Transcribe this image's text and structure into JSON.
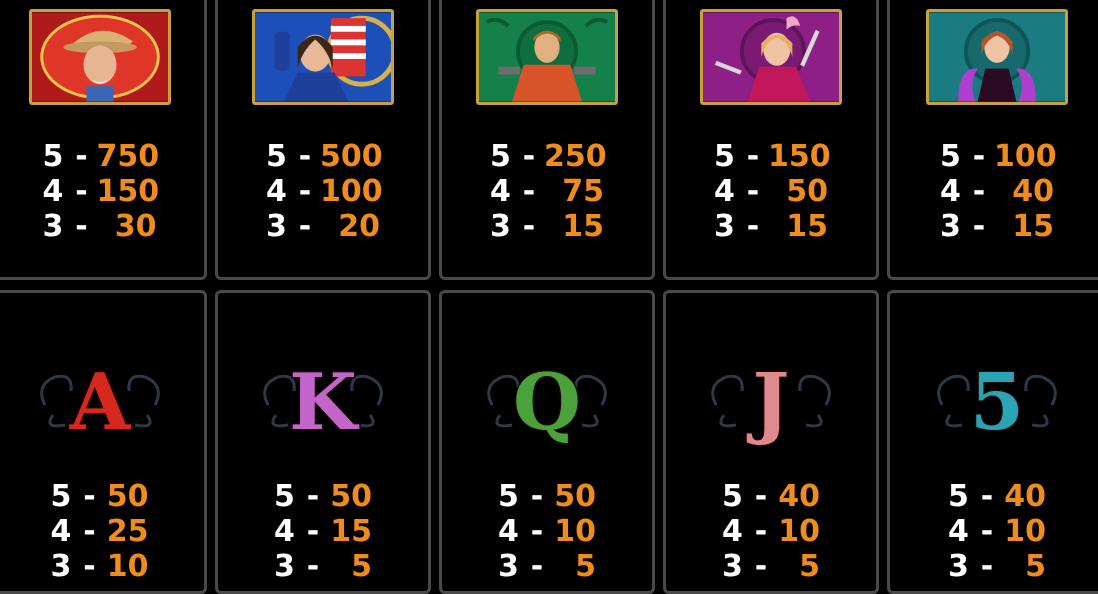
{
  "theme": {
    "background": "#000000",
    "border": "#4a4a4a",
    "count_color": "#ffffff",
    "payout_color": "#f08c1c"
  },
  "symbols": [
    {
      "icon": "old-cowboy-portrait",
      "frame": "#c8a13a",
      "bg": "#b11a1a",
      "payouts": [
        {
          "count": "5",
          "value": "750"
        },
        {
          "count": "4",
          "value": "150"
        },
        {
          "count": "3",
          "value": "30"
        }
      ]
    },
    {
      "icon": "cowgirl-flag-portrait",
      "frame": "#c8a13a",
      "bg": "#1d4fb8",
      "payouts": [
        {
          "count": "5",
          "value": "500"
        },
        {
          "count": "4",
          "value": "100"
        },
        {
          "count": "3",
          "value": "20"
        }
      ]
    },
    {
      "icon": "gunslinger-portrait",
      "frame": "#c8a13a",
      "bg": "#14804a",
      "payouts": [
        {
          "count": "5",
          "value": "250"
        },
        {
          "count": "4",
          "value": "75"
        },
        {
          "count": "3",
          "value": "15"
        }
      ]
    },
    {
      "icon": "knife-girl-portrait",
      "frame": "#c8a13a",
      "bg": "#8e1f86",
      "payouts": [
        {
          "count": "5",
          "value": "150"
        },
        {
          "count": "4",
          "value": "50"
        },
        {
          "count": "3",
          "value": "15"
        }
      ]
    },
    {
      "icon": "showgirl-portrait",
      "frame": "#c8a13a",
      "bg": "#1a7b80",
      "payouts": [
        {
          "count": "5",
          "value": "100"
        },
        {
          "count": "4",
          "value": "40"
        },
        {
          "count": "3",
          "value": "15"
        }
      ]
    },
    {
      "letter": "A",
      "color": "#d6281e",
      "payouts": [
        {
          "count": "5",
          "value": "50"
        },
        {
          "count": "4",
          "value": "25"
        },
        {
          "count": "3",
          "value": "10"
        }
      ]
    },
    {
      "letter": "K",
      "color": "#c266c9",
      "payouts": [
        {
          "count": "5",
          "value": "50"
        },
        {
          "count": "4",
          "value": "15"
        },
        {
          "count": "3",
          "value": "5"
        }
      ]
    },
    {
      "letter": "Q",
      "color": "#4aa23a",
      "payouts": [
        {
          "count": "5",
          "value": "50"
        },
        {
          "count": "4",
          "value": "10"
        },
        {
          "count": "3",
          "value": "5"
        }
      ]
    },
    {
      "letter": "J",
      "color": "#e08a8e",
      "payouts": [
        {
          "count": "5",
          "value": "40"
        },
        {
          "count": "4",
          "value": "10"
        },
        {
          "count": "3",
          "value": "5"
        }
      ]
    },
    {
      "letter": "5",
      "color": "#2aa3b5",
      "payouts": [
        {
          "count": "5",
          "value": "40"
        },
        {
          "count": "4",
          "value": "10"
        },
        {
          "count": "3",
          "value": "5"
        }
      ]
    }
  ],
  "separator": "-"
}
